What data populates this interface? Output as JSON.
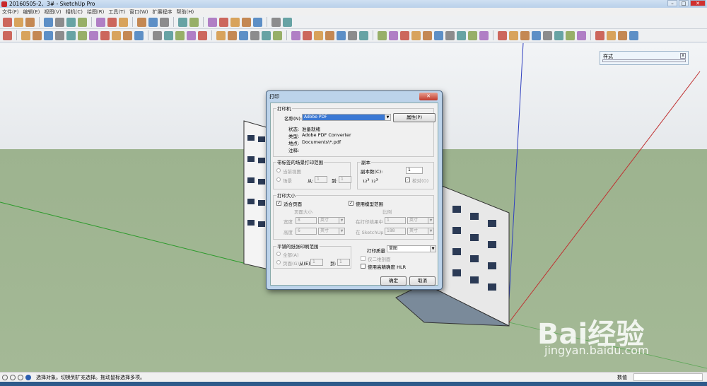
{
  "window": {
    "title": "20160505-2、3# - SketchUp Pro",
    "min": "–",
    "max": "□",
    "close": "✕"
  },
  "menu": [
    "文件(F)",
    "编辑(E)",
    "视图(V)",
    "相机(C)",
    "绘图(R)",
    "工具(T)",
    "窗口(W)",
    "扩展程序",
    "帮助(H)"
  ],
  "styles_panel": {
    "title": "样式",
    "close": "x"
  },
  "dialog": {
    "title": "打印",
    "close": "✕",
    "printer": {
      "legend": "打印机",
      "name_label": "名称(N):",
      "name_value": "Adobe PDF",
      "properties_button": "属性(P)",
      "status_label": "状态:",
      "status_value": "准备就绪",
      "type_label": "类型:",
      "type_value": "Adobe PDF Converter",
      "where_label": "地点:",
      "where_value": "Documents\\*.pdf",
      "comment_label": "注释:"
    },
    "scene_range": {
      "legend": "带标签的场景打印范围",
      "current_view": "当前视图",
      "scenes": "场景",
      "from_label": "从:",
      "from_value": "1",
      "to_label": "到:",
      "to_value": "1"
    },
    "copies": {
      "legend": "副本",
      "count_label": "副本数(C):",
      "count_value": "1",
      "collate": "校对(O)",
      "collate_checked": true
    },
    "print_size": {
      "legend": "打印大小",
      "fit_page": "适合页面",
      "fit_page_checked": true,
      "use_model_extents": "使用模型范围",
      "use_model_extents_checked": true,
      "page_size_label": "页面大小",
      "width_label": "宽度",
      "width_value": "8",
      "width_unit": "英寸",
      "height_label": "高度",
      "height_value": "6",
      "height_unit": "英寸",
      "scale_label": "比例",
      "in_printout_label": "在打印结果中",
      "in_printout_value": "1",
      "in_printout_unit": "英寸",
      "in_sketchup_label": "在 SketchUp 中",
      "in_sketchup_value": "188",
      "in_sketchup_unit": "英寸"
    },
    "tiled_range": {
      "legend": "平铺的纸张印刷范围",
      "all": "全部(A)",
      "pages": "页面(G)",
      "from_label": "从(E):",
      "from_value": "1",
      "to_label": "到:",
      "to_value": "1"
    },
    "quality_label": "打印质量",
    "quality_value": "草图",
    "two_d_section": "仅二维剖面",
    "high_accuracy_hlr": "使用高精确度 HLR",
    "ok": "确定",
    "cancel": "取消"
  },
  "statusbar": {
    "message": "选择对象。切换到扩充选择。拖动鼠标选择多项。",
    "measurements_label": "数值",
    "measurements_value": ""
  },
  "watermark": {
    "brand": "Bai经验",
    "url": "jingyan.baidu.com"
  }
}
